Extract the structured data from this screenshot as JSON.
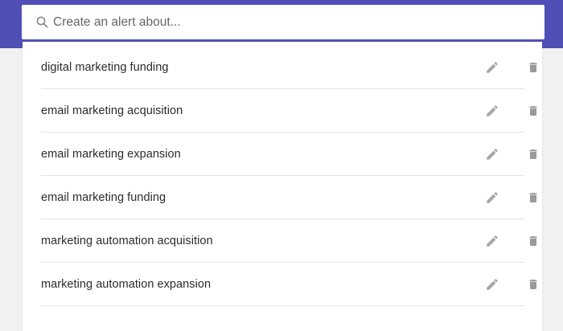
{
  "search": {
    "placeholder": "Create an alert about...",
    "icon": "search-icon"
  },
  "alerts": [
    {
      "label": "digital marketing funding",
      "edit_icon": "pencil-icon",
      "delete_icon": "trash-icon"
    },
    {
      "label": "email marketing acquisition",
      "edit_icon": "pencil-icon",
      "delete_icon": "trash-icon"
    },
    {
      "label": "email marketing expansion",
      "edit_icon": "pencil-icon",
      "delete_icon": "trash-icon"
    },
    {
      "label": "email marketing funding",
      "edit_icon": "pencil-icon",
      "delete_icon": "trash-icon"
    },
    {
      "label": "marketing automation acquisition",
      "edit_icon": "pencil-icon",
      "delete_icon": "trash-icon"
    },
    {
      "label": "marketing automation expansion",
      "edit_icon": "pencil-icon",
      "delete_icon": "trash-icon"
    }
  ],
  "colors": {
    "header_band": "#4f4fb6",
    "page_background": "#f1f1f1",
    "icon_gray": "#9e9e9e",
    "text": "#2b2b2b"
  }
}
